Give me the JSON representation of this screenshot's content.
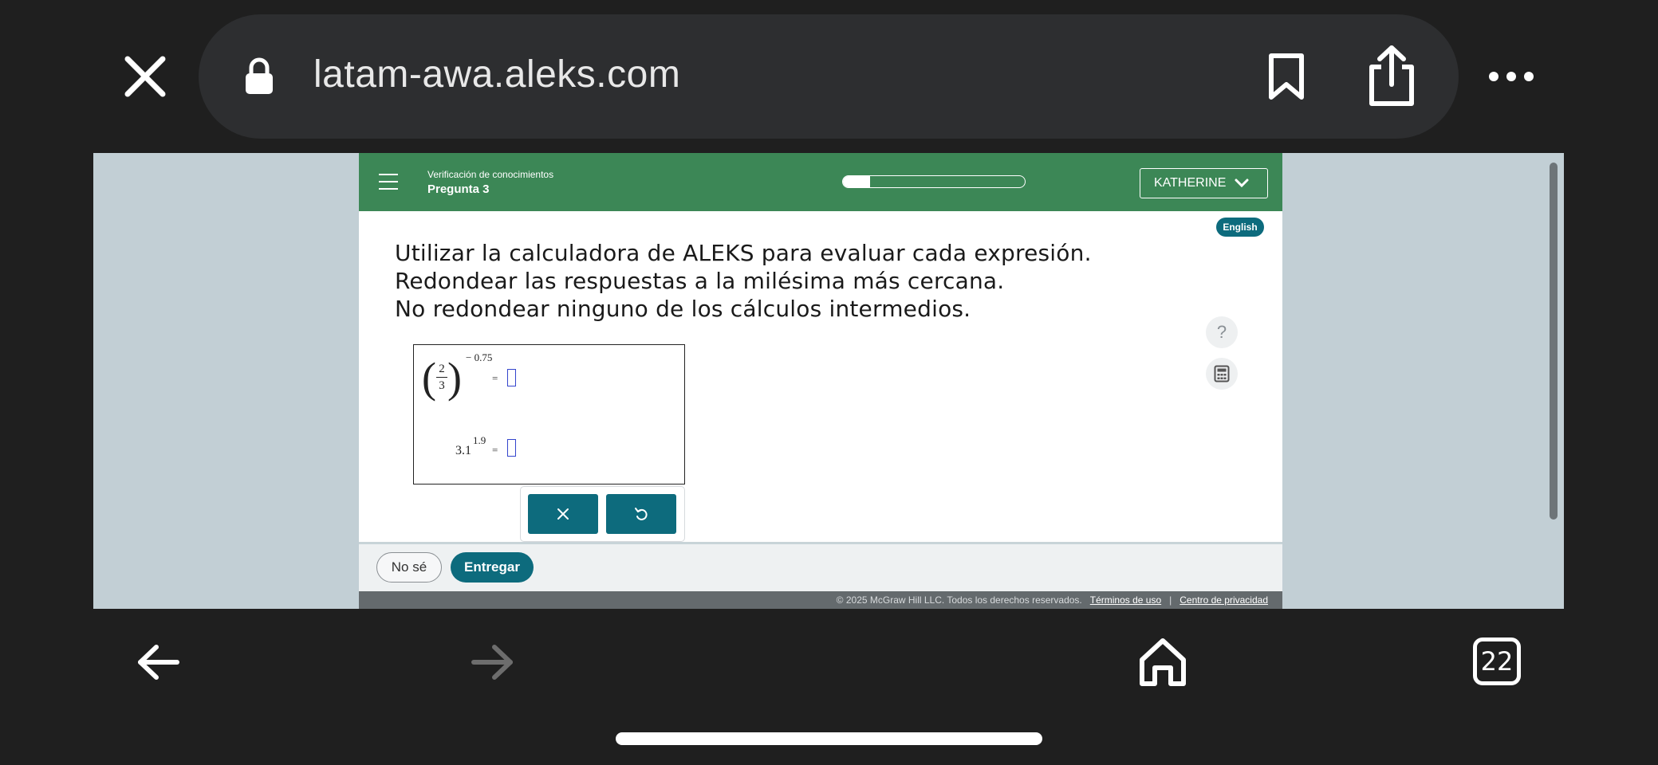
{
  "browser": {
    "url": "latam-awa.aleks.com",
    "tab_count": "22"
  },
  "aleks": {
    "header": {
      "section_label": "Verificación de conocimientos",
      "question_label": "Pregunta 3",
      "progress_fraction": 0.15,
      "user_name": "KATHERINE"
    },
    "language_badge": "English",
    "instructions": [
      "Utilizar la calculadora de ALEKS para evaluar cada expresión.",
      "Redondear las respuestas a la milésima más cercana.",
      "No redondear ninguno de los cálculos intermedios."
    ],
    "expressions": {
      "e1_numerator": "2",
      "e1_denominator": "3",
      "e1_exponent": "− 0.75",
      "e2_base": "3.1",
      "e2_exponent": "1.9",
      "equals": "="
    },
    "help_label": "?",
    "footer": {
      "dont_know": "No sé",
      "submit": "Entregar",
      "copyright": "© 2025 McGraw Hill LLC. Todos los derechos reservados.",
      "terms": "Términos de uso",
      "separator": "|",
      "privacy": "Centro de privacidad"
    }
  },
  "colors": {
    "header_green": "#3c8756",
    "teal": "#0d6b7d",
    "browser_bg": "#1f1f1f"
  }
}
